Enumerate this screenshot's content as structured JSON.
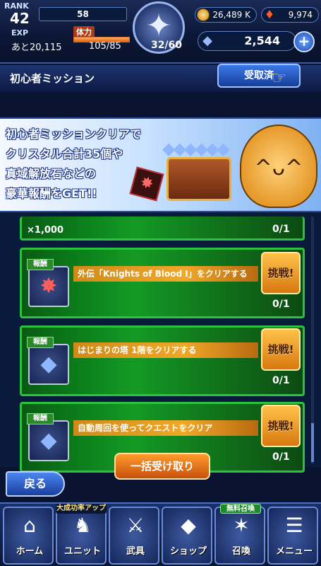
{
  "status": {
    "rank_label": "RANK",
    "rank_value": "42",
    "exp_bar_value": "58",
    "exp_label": "EXP",
    "exp_remaining": "あと20,115",
    "stamina_label": "体力",
    "stamina_value": "105/85",
    "stamina_counter": "32/60",
    "gold": "26,489 K",
    "medals": "9,974",
    "crystals": "2,544",
    "plus_symbol": "+",
    "stamina_fill_fraction": 1.0
  },
  "header": {
    "title": "初心者ミッション",
    "received_button": "受取済"
  },
  "banner": {
    "line1": "初心者ミッションクリアで",
    "line2": "クリスタル合計35個や",
    "line3": "真域解放石などの",
    "line4": "豪華報酬をGET!!"
  },
  "missions": {
    "partial": {
      "quantity": "×1,000",
      "progress": "0/1"
    },
    "items": [
      {
        "reward_tag": "報酬",
        "description": "外伝「Knights of Blood Ⅰ」をクリアする",
        "button": "挑戦!",
        "progress": "0/1",
        "reward_icon": "red-stone-icon"
      },
      {
        "reward_tag": "報酬",
        "description": "はじまりの塔 1階をクリアする",
        "button": "挑戦!",
        "progress": "0/1",
        "reward_icon": "crystal-icon"
      },
      {
        "reward_tag": "報酬",
        "description": "自動周回を使ってクエストをクリア",
        "button": "挑戦!",
        "progress": "0/1",
        "reward_icon": "crystal-icon"
      }
    ]
  },
  "controls": {
    "bulk_receive": "一括受け取り",
    "back": "戻る"
  },
  "nav": {
    "items": [
      {
        "label": "ホーム",
        "badge": ""
      },
      {
        "label": "ユニット",
        "badge": "大成功率アップ"
      },
      {
        "label": "武具",
        "badge": ""
      },
      {
        "label": "ショップ",
        "badge": ""
      },
      {
        "label": "召喚",
        "badge": "無料召喚"
      },
      {
        "label": "メニュー",
        "badge": ""
      }
    ]
  },
  "colors": {
    "card_border": "#2cc240",
    "challenge_button": "#f0a828",
    "accent_blue": "#3b78e8"
  }
}
